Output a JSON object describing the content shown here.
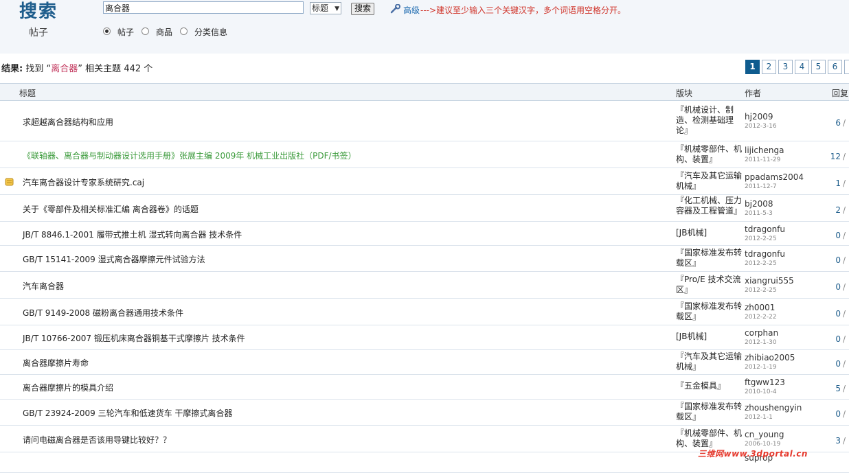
{
  "header": {
    "title": "搜索",
    "subtitle": "帖子",
    "search_value": "离合器",
    "select_value": "标题",
    "search_button": "搜索",
    "advanced_label": "高级",
    "advanced_hint": "--->建议至少输入三个关键汉字，多个词语用空格分开。",
    "radios": [
      {
        "label": "帖子",
        "checked": true
      },
      {
        "label": "商品",
        "checked": false
      },
      {
        "label": "分类信息",
        "checked": false
      }
    ]
  },
  "result": {
    "prefix": "结果:",
    "found": "找到",
    "quote_open": "“",
    "keyword": "离合器",
    "quote_close": "”",
    "suffix": "相关主题",
    "count": "442 个"
  },
  "pagination": {
    "current": "1",
    "pages": [
      "1",
      "2",
      "3",
      "4",
      "5",
      "6"
    ]
  },
  "table": {
    "headers": {
      "title": "标题",
      "forum": "版块",
      "author": "作者",
      "replies": "回复"
    },
    "rows": [
      {
        "title": "求超越离合器结构和应用",
        "forum": "『机械设计、制造、检测基础理论』",
        "author": "hj2009",
        "date": "2012-3-16",
        "replies": "6"
      },
      {
        "title": "《联轴器、离合器与制动器设计选用手册》张展主编 2009年 机械工业出版社（PDF/书签）",
        "forum": "『机械零部件、机构、装置』",
        "author": "lijichenga",
        "date": "2011-11-29",
        "replies": "12",
        "green": true
      },
      {
        "title": "汽车离合器设计专家系统研究.caj",
        "forum": "『汽车及其它运输机械』",
        "author": "ppadams2004",
        "date": "2011-12-7",
        "replies": "1",
        "icon": "attachment-icon"
      },
      {
        "title": "关于《零部件及相关标准汇编 离合器卷》的话题",
        "forum": "『化工机械、压力容器及工程管道』",
        "author": "bj2008",
        "date": "2011-5-3",
        "replies": "2"
      },
      {
        "title": "JB/T 8846.1-2001 履带式推土机 湿式转向离合器 技术条件",
        "forum": "[JB机械]",
        "author": "tdragonfu",
        "date": "2012-2-25",
        "replies": "0"
      },
      {
        "title": "GB/T 15141-2009 湿式离合器摩擦元件试验方法",
        "forum": "『国家标准发布转载区』",
        "author": "tdragonfu",
        "date": "2012-2-25",
        "replies": "0"
      },
      {
        "title": "汽车离合器",
        "forum": "『Pro/E 技术交流区』",
        "author": "xiangrui555",
        "date": "2012-2-25",
        "replies": "0"
      },
      {
        "title": "GB/T 9149-2008 磁粉离合器通用技术条件",
        "forum": "『国家标准发布转载区』",
        "author": "zh0001",
        "date": "2012-2-22",
        "replies": "0"
      },
      {
        "title": "JB/T 10766-2007 锻压机床离合器铜基干式摩擦片 技术条件",
        "forum": "[JB机械]",
        "author": "corphan",
        "date": "2012-1-30",
        "replies": "0"
      },
      {
        "title": "离合器摩擦片寿命",
        "forum": "『汽车及其它运输机械』",
        "author": "zhibiao2005",
        "date": "2012-1-19",
        "replies": "0"
      },
      {
        "title": "离合器摩擦片的模具介绍",
        "forum": "『五金模具』",
        "author": "ftgww123",
        "date": "2010-10-4",
        "replies": "5"
      },
      {
        "title": "GB/T 23924-2009 三轮汽车和低速货车 干摩擦式离合器",
        "forum": "『国家标准发布转载区』",
        "author": "zhoushengyin",
        "date": "2012-1-1",
        "replies": "0"
      },
      {
        "title": "请问电磁离合器是否该用导键比较好？？",
        "forum": "『机械零部件、机构、装置』",
        "author": "cn_young",
        "date": "2006-10-19",
        "replies": "3"
      },
      {
        "title": "",
        "forum": "",
        "author": "suprop",
        "date": "",
        "replies": ""
      }
    ]
  },
  "watermark": "三维网www.3dportal.cn"
}
